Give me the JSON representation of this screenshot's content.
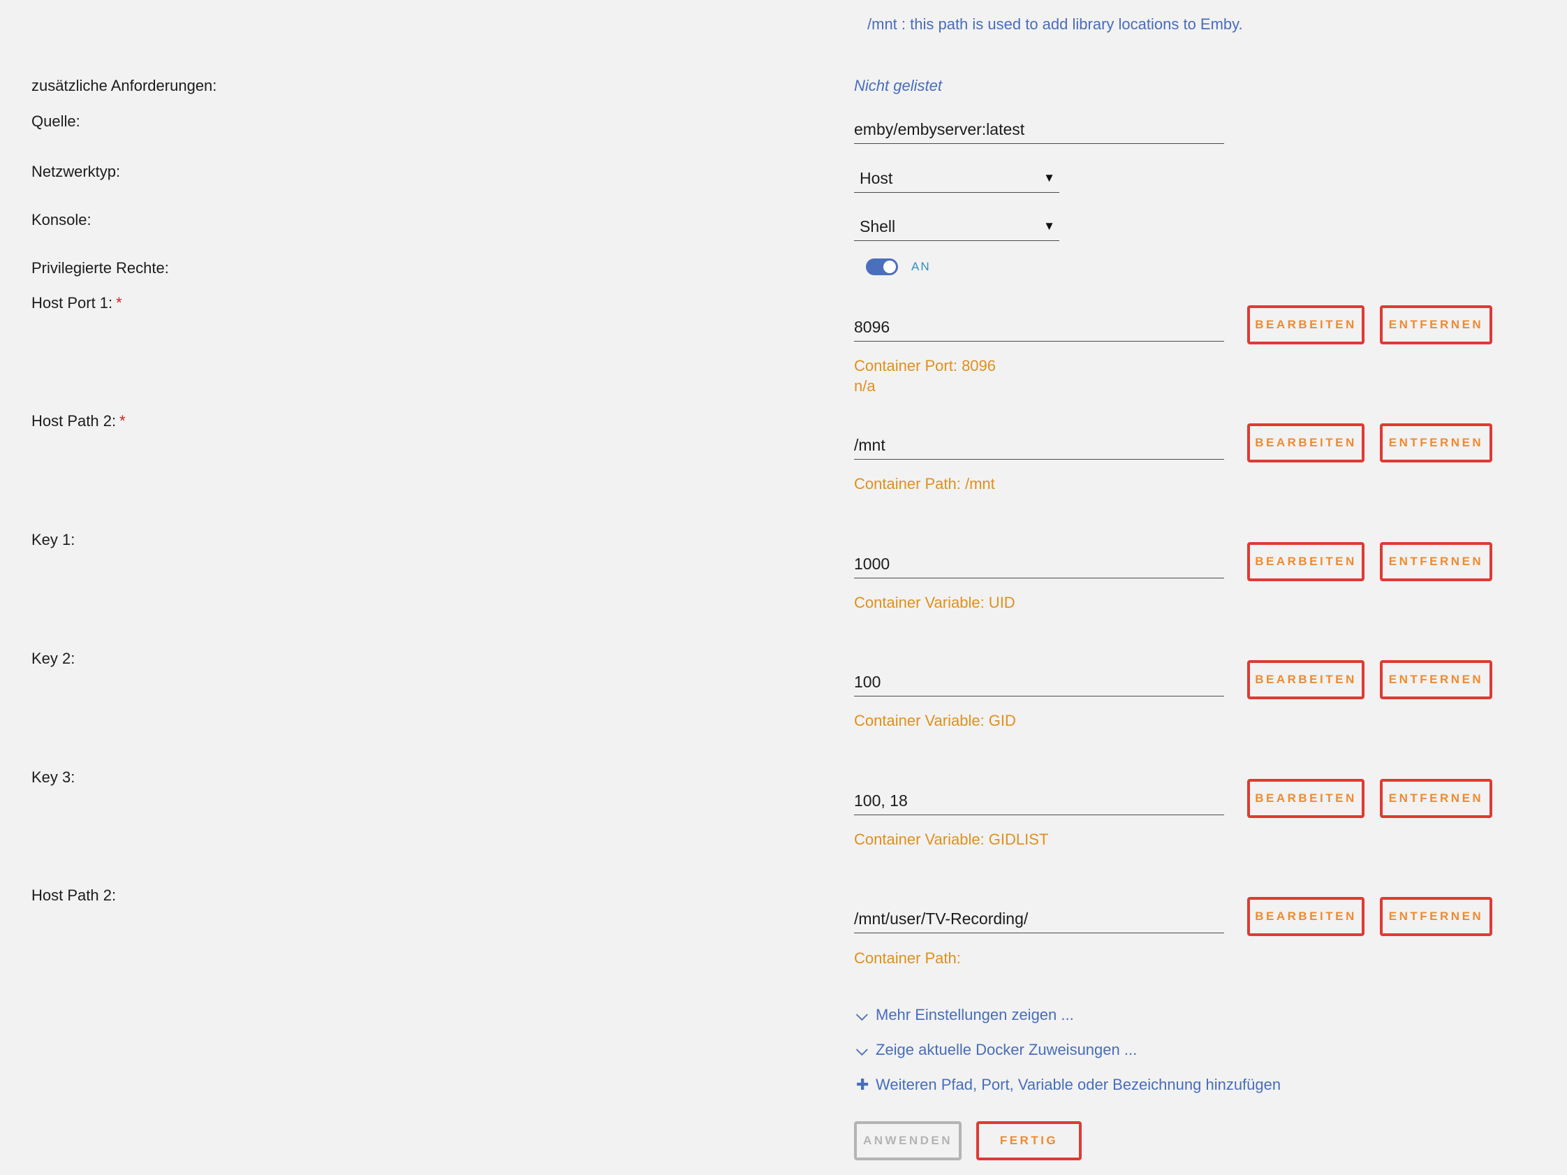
{
  "path_hint": "/mnt : this path is used to add library locations to Emby.",
  "fields": {
    "requirements_label": "zusätzliche Anforderungen:",
    "requirements_value": "Nicht gelistet",
    "source_label": "Quelle:",
    "source_value": "emby/embyserver:latest",
    "network_label": "Netzwerktyp:",
    "network_value": "Host",
    "console_label": "Konsole:",
    "console_value": "Shell",
    "privileged_label": "Privilegierte Rechte:",
    "privileged_value": "AN",
    "privileged_on": true
  },
  "entries": [
    {
      "label": "Host Port 1:",
      "required": "*",
      "value": "8096",
      "sub1": "Container Port: 8096",
      "sub2": "n/a"
    },
    {
      "label": "Host Path 2:",
      "required": "*",
      "value": "/mnt",
      "sub1": "Container Path: /mnt"
    },
    {
      "label": "Key 1:",
      "value": "1000",
      "sub1": "Container Variable: UID"
    },
    {
      "label": "Key 2:",
      "value": "100",
      "sub1": "Container Variable: GID"
    },
    {
      "label": "Key 3:",
      "value": "100, 18",
      "sub1": "Container Variable: GIDLIST"
    },
    {
      "label": "Host Path 2:",
      "value": "/mnt/user/TV-Recording/",
      "sub1": "Container Path:"
    }
  ],
  "buttons": {
    "edit": "BEARBEITEN",
    "remove": "ENTFERNEN",
    "apply": "ANWENDEN",
    "done": "FERTIG"
  },
  "links": {
    "more_settings": "Mehr Einstellungen zeigen ...",
    "show_allocations": "Zeige aktuelle Docker Zuweisungen ...",
    "add_config": "Weiteren Pfad, Port, Variable oder Bezeichnung hinzufügen"
  },
  "icons": {
    "more_settings": "chevron-down-icon",
    "show_allocations": "chevron-down-icon",
    "add_config": "plus-icon",
    "select_caret": "caret-down-icon"
  },
  "colors": {
    "background": "#f2f2f2",
    "link_blue": "#486dba",
    "accent_orange": "#e0901c",
    "button_border": "#e03a34",
    "button_text": "#ef8a2f",
    "toggle_on": "#4a70bd",
    "required_star": "#cc2222",
    "disabled_gray": "#b4b4b4"
  }
}
